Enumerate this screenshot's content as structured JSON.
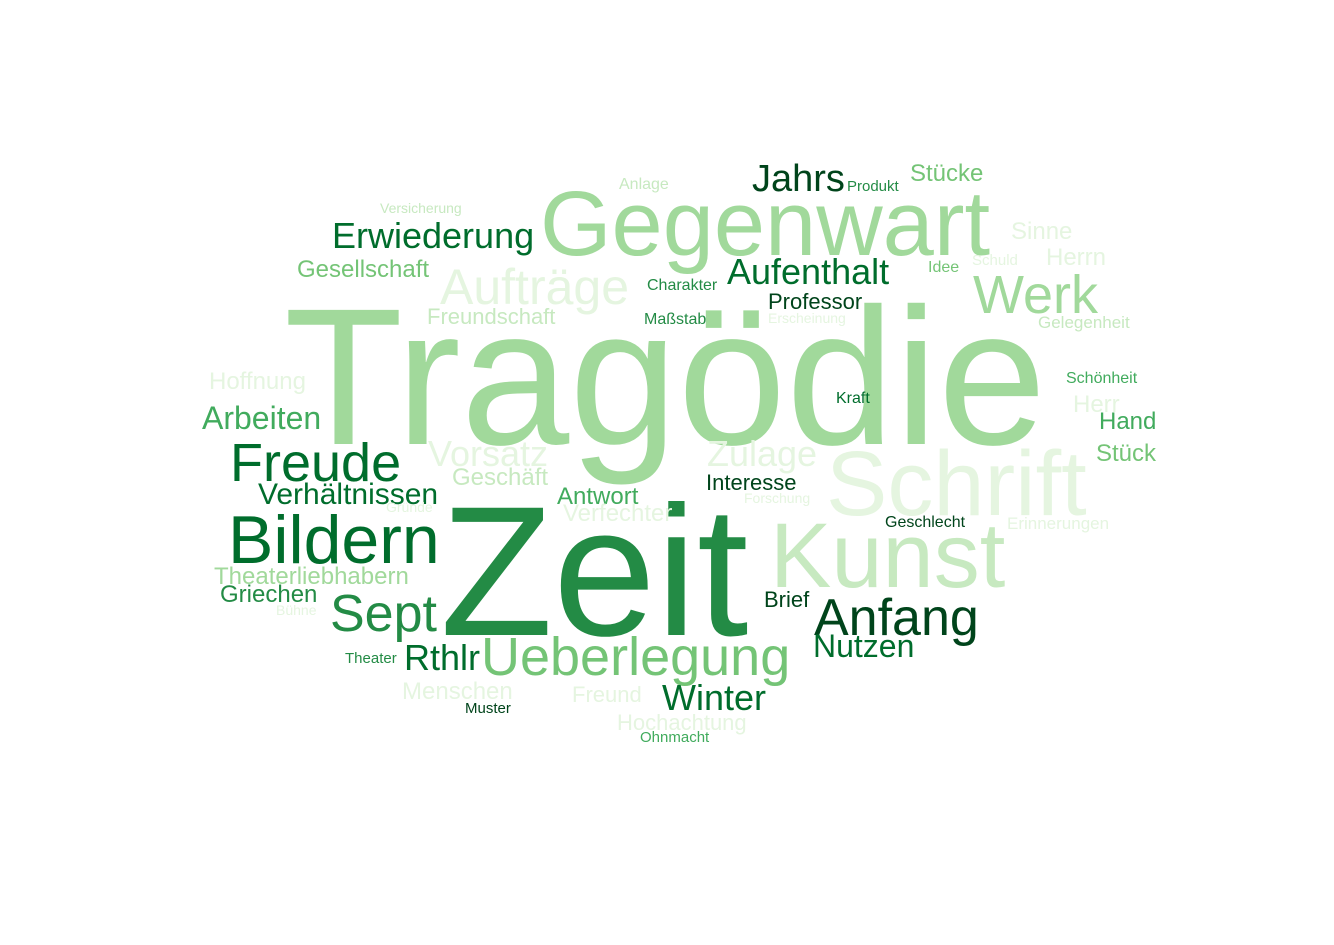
{
  "palette": {
    "darkest": "#00441b",
    "dark": "#006d2c",
    "medium_dark": "#238b45",
    "medium": "#41ab5d",
    "light": "#74c476",
    "lighter": "#a1d99b",
    "lightest": "#c7e9c0",
    "faint": "#e5f5e0"
  },
  "words": [
    {
      "text": "Tragödie",
      "color": "#a1d99b"
    },
    {
      "text": "Zeit",
      "color": "#238b45"
    },
    {
      "text": "Gegenwart",
      "color": "#a1d99b"
    },
    {
      "text": "Schrift",
      "color": "#e5f5e0"
    },
    {
      "text": "Kunst",
      "color": "#c7e9c0"
    },
    {
      "text": "Bildern",
      "color": "#006d2c"
    },
    {
      "text": "Aufträge",
      "color": "#e5f5e0"
    },
    {
      "text": "Freude",
      "color": "#006d2c"
    },
    {
      "text": "Werk",
      "color": "#a1d99b"
    },
    {
      "text": "Ueberlegung",
      "color": "#74c476"
    },
    {
      "text": "Anfang",
      "color": "#00441b"
    },
    {
      "text": "Sept",
      "color": "#238b45"
    },
    {
      "text": "Erwiederung",
      "color": "#006d2c"
    },
    {
      "text": "Aufenthalt",
      "color": "#006d2c"
    },
    {
      "text": "Jahrs",
      "color": "#00441b"
    },
    {
      "text": "Vorsatz",
      "color": "#e5f5e0"
    },
    {
      "text": "Zulage",
      "color": "#e5f5e0"
    },
    {
      "text": "Winter",
      "color": "#006d2c"
    },
    {
      "text": "Rthlr",
      "color": "#006d2c"
    },
    {
      "text": "Arbeiten",
      "color": "#41ab5d"
    },
    {
      "text": "Nutzen",
      "color": "#006d2c"
    },
    {
      "text": "Verhältnissen",
      "color": "#006d2c"
    },
    {
      "text": "Gesellschaft",
      "color": "#74c476"
    },
    {
      "text": "Freundschaft",
      "color": "#c7e9c0"
    },
    {
      "text": "Hoffnung",
      "color": "#e5f5e0"
    },
    {
      "text": "Theaterliebhabern",
      "color": "#a1d99b"
    },
    {
      "text": "Griechen",
      "color": "#238b45"
    },
    {
      "text": "Menschen",
      "color": "#e5f5e0"
    },
    {
      "text": "Geschäft",
      "color": "#c7e9c0"
    },
    {
      "text": "Antwort",
      "color": "#41ab5d"
    },
    {
      "text": "Verfechter",
      "color": "#e5f5e0"
    },
    {
      "text": "Interesse",
      "color": "#00441b"
    },
    {
      "text": "Professor",
      "color": "#00441b"
    },
    {
      "text": "Stücke",
      "color": "#74c476"
    },
    {
      "text": "Herrn",
      "color": "#e5f5e0"
    },
    {
      "text": "Sinne",
      "color": "#e5f5e0"
    },
    {
      "text": "Hand",
      "color": "#41ab5d"
    },
    {
      "text": "Stück",
      "color": "#74c476"
    },
    {
      "text": "Herr",
      "color": "#e5f5e0"
    },
    {
      "text": "Brief",
      "color": "#00441b"
    },
    {
      "text": "Freund",
      "color": "#e5f5e0"
    },
    {
      "text": "Hochachtung",
      "color": "#e5f5e0"
    },
    {
      "text": "Erinnerungen",
      "color": "#e5f5e0"
    },
    {
      "text": "Gelegenheit",
      "color": "#c7e9c0"
    },
    {
      "text": "Schönheit",
      "color": "#41ab5d"
    },
    {
      "text": "Geschlecht",
      "color": "#00441b"
    },
    {
      "text": "Charakter",
      "color": "#238b45"
    },
    {
      "text": "Maßstab",
      "color": "#238b45"
    },
    {
      "text": "Kraft",
      "color": "#006d2c"
    },
    {
      "text": "Anlage",
      "color": "#c7e9c0"
    },
    {
      "text": "Produkt",
      "color": "#238b45"
    },
    {
      "text": "Idee",
      "color": "#74c476"
    },
    {
      "text": "Schuld",
      "color": "#e5f5e0"
    },
    {
      "text": "Versicherung",
      "color": "#c7e9c0"
    },
    {
      "text": "Theater",
      "color": "#238b45"
    },
    {
      "text": "Muster",
      "color": "#00441b"
    },
    {
      "text": "Ohnmacht",
      "color": "#41ab5d"
    },
    {
      "text": "Bühne",
      "color": "#e5f5e0"
    },
    {
      "text": "Erscheinung",
      "color": "#e5f5e0"
    },
    {
      "text": "Gründe",
      "color": "#e5f5e0"
    },
    {
      "text": "Forschung",
      "color": "#e5f5e0"
    }
  ]
}
